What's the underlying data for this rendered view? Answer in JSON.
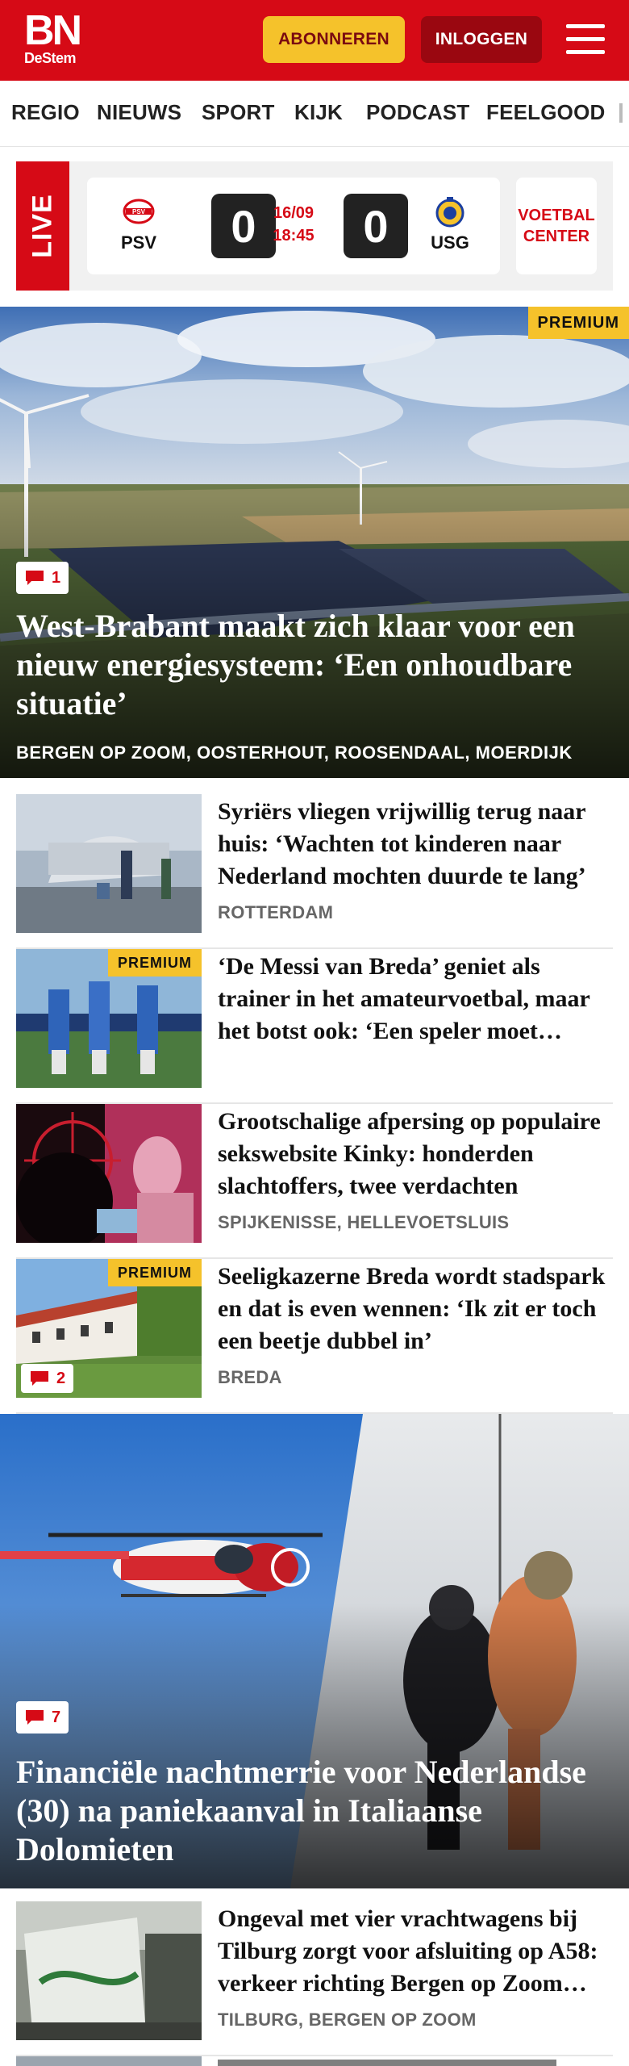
{
  "header": {
    "logo_main": "BN",
    "logo_sub": "DeStem",
    "subscribe_label": "ABONNEREN",
    "login_label": "INLOGGEN",
    "brand_color": "#d60a16",
    "accent_color": "#f5c22b"
  },
  "nav": {
    "items": [
      "REGIO",
      "NIEUWS",
      "SPORT",
      "KIJK",
      "PODCAST",
      "FEELGOOD"
    ]
  },
  "live": {
    "tag": "LIVE",
    "home_team": "PSV",
    "away_team": "USG",
    "home_score": "0",
    "away_score": "0",
    "date": "16/09",
    "time": "18:45",
    "center_label": "VOETBAL CENTER"
  },
  "hero": {
    "premium_label": "PREMIUM",
    "comment_count": "1",
    "title": "West-Brabant maakt zich klaar voor een nieuw energiesysteem: ‘Een onhoudbare situatie’",
    "locations": "BERGEN OP ZOOM, OOSTERHOUT, ROOSENDAAL, MOERDIJK"
  },
  "articles": [
    {
      "title": "Syriërs vliegen vrijwillig terug naar huis: ‘Wachten tot kinderen naar Nederland mochten duurde te lang’",
      "location": "ROTTERDAM"
    },
    {
      "premium_label": "PREMIUM",
      "title": "‘De Messi van Breda’ geniet als trainer in het amateurvoetbal, maar het botst ook: ‘Een speler moet luisteren’",
      "location": ""
    },
    {
      "title": "Grootschalige afpersing op populaire sekswebsite Kinky: honderden slachtoffers, twee verdachten",
      "location": "SPIJKENISSE, HELLEVOETSLUIS"
    },
    {
      "premium_label": "PREMIUM",
      "comment_count": "2",
      "title": "Seeligkazerne Breda wordt stadspark en dat is even wennen: ‘Ik zit er toch een beetje dubbel in’",
      "location": "BREDA"
    }
  ],
  "hero2": {
    "comment_count": "7",
    "title": "Financiële nachtmerrie voor Nederlandse (30) na paniekaanval in Italiaanse Dolomieten"
  },
  "article_last": {
    "title": "Ongeval met vier vrachtwagens bij Tilburg zorgt voor afsluiting op A58: verkeer richting Bergen op Zoom staat stil",
    "location": "TILBURG, BERGEN OP ZOOM"
  }
}
